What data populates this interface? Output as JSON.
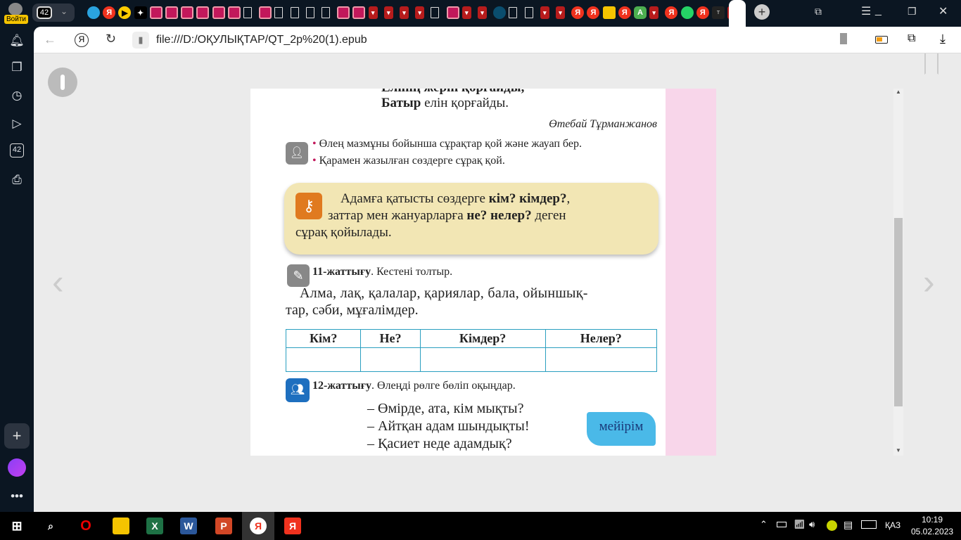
{
  "browser": {
    "profile_label": "Войти",
    "tab_count": "42",
    "tabs": [
      "telegram",
      "yandex",
      "play",
      "star",
      "wordpad",
      "wordpad",
      "wordpad",
      "wordpad",
      "wordpad",
      "wordpad",
      "document",
      "wordpad",
      "document",
      "document",
      "document",
      "document",
      "wordpad",
      "wordpad",
      "pdf",
      "pdf",
      "pdf",
      "pdf",
      "document",
      "wordpad",
      "pdf",
      "pdf",
      "globe",
      "document",
      "document",
      "pdf",
      "pdf",
      "yandex",
      "yandex",
      "image",
      "yandex",
      "a-app",
      "pdf",
      "yandex",
      "whatsapp",
      "yandex",
      "more",
      "pdf-active"
    ],
    "address": "file:///D:/ОҚУЛЫҚТАР/QT_2p%20(1).epub",
    "sidebar_count": "42",
    "accent": "#f0321e"
  },
  "book": {
    "line_cut": "Елінің жерін қорғайды,",
    "line1_bold": "Батыр",
    "line1_rest": " елін қорғайды.",
    "author": "Өтебай Тұрманжанов",
    "bullets": [
      "Өлең мазмұны бойынша сұрақтар қой және жауап бер.",
      "Қарамен жазылған сөздерге сұрақ қой."
    ],
    "rule": {
      "p1": "Адамға қатысты сөздерге ",
      "b1": "кім? кімдер?",
      ",": ",",
      "p2": "заттар мен жануарларға ",
      "b2": "не? нелер?",
      "p3": " деген",
      "p4": "сұрақ қойылады."
    },
    "ex11": {
      "num": "11-жаттығу",
      "task": ". Кестені толтыр.",
      "text1": "Алма, лақ, қалалар, қариялар, бала, ойыншық-",
      "text2": "тар, сәби, мұғалімдер."
    },
    "table_headers": [
      "Кім?",
      "Не?",
      "Кімдер?",
      "Нелер?"
    ],
    "ex12": {
      "num": "12-жаттығу",
      "task": ". Өлеңді рөлге бөліп оқыңдар.",
      "lines": [
        "– Өмірде, ата, кім мықты?",
        "– Айтқан адам шындықты!",
        "– Қасиет неде адамдық?"
      ]
    },
    "flag_word": "мейірім"
  },
  "taskbar": {
    "lang": "ҚАЗ",
    "time": "10:19",
    "date": "05.02.2023"
  }
}
